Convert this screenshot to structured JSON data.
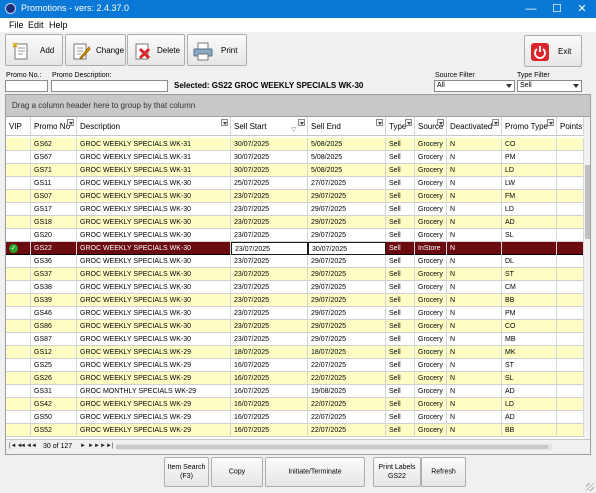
{
  "window": {
    "title": "Promotions - vers: 2.4.37.0",
    "minimize_glyph": "—",
    "maximize_glyph": "☐",
    "close_glyph": "✕"
  },
  "menu": [
    "File",
    "Edit",
    "Help"
  ],
  "toolbar": {
    "add_label": "Add",
    "change_label": "Change",
    "delete_label": "Delete",
    "print_label": "Print",
    "exit_label": "Exit"
  },
  "filters": {
    "promo_no_label": "Promo No.:",
    "promo_no_value": "",
    "promo_desc_label": "Promo Description:",
    "promo_desc_value": "",
    "selected_text": "Selected: GS22 GROC WEEKLY SPECIALS WK-30",
    "source_filter_label": "Source Filter",
    "source_filter_value": "All",
    "type_filter_label": "Type Filter",
    "type_filter_value": "Sell"
  },
  "grid": {
    "group_panel_text": "Drag a column header here to group by that column",
    "columns": [
      "VIP",
      "Promo No",
      "Description",
      "Sell Start",
      "Sell End",
      "Type",
      "Source",
      "Deactivated",
      "Promo Type",
      "Points Itm"
    ],
    "rows": [
      [
        "",
        "GS62",
        "GROC WEEKLY SPECIALS WK-31",
        "30/07/2025",
        "5/08/2025",
        "Sell",
        "Grocery",
        "N",
        "CO",
        ""
      ],
      [
        "",
        "GS67",
        "GROC WEEKLY SPECIALS WK-31",
        "30/07/2025",
        "5/08/2025",
        "Sell",
        "Grocery",
        "N",
        "PM",
        ""
      ],
      [
        "",
        "GS71",
        "GROC WEEKLY SPECIALS WK-31",
        "30/07/2025",
        "5/08/2025",
        "Sell",
        "Grocery",
        "N",
        "LD",
        ""
      ],
      [
        "",
        "GS11",
        "GROC WEEKLY SPECIALS WK-30",
        "25/07/2025",
        "27/07/2025",
        "Sell",
        "Grocery",
        "N",
        "LW",
        ""
      ],
      [
        "",
        "GS07",
        "GROC WEEKLY SPECIALS WK-30",
        "23/07/2025",
        "29/07/2025",
        "Sell",
        "Grocery",
        "N",
        "FM",
        ""
      ],
      [
        "",
        "GS17",
        "GROC WEEKLY SPECIALS WK-30",
        "23/07/2025",
        "29/07/2025",
        "Sell",
        "Grocery",
        "N",
        "LD",
        ""
      ],
      [
        "",
        "GS18",
        "GROC WEEKLY SPECIALS WK-30",
        "23/07/2025",
        "29/07/2025",
        "Sell",
        "Grocery",
        "N",
        "AD",
        ""
      ],
      [
        "",
        "GS20",
        "GROC WEEKLY SPECIALS WK-30",
        "23/07/2025",
        "29/07/2025",
        "Sell",
        "Grocery",
        "N",
        "SL",
        ""
      ],
      [
        "",
        "GS22",
        "GROC WEEKLY SPECIALS WK-30",
        "23/07/2025",
        "30/07/2025",
        "Sell",
        "InStore",
        "N",
        "",
        ""
      ],
      [
        "",
        "GS36",
        "GROC WEEKLY SPECIALS WK-30",
        "23/07/2025",
        "29/07/2025",
        "Sell",
        "Grocery",
        "N",
        "DL",
        ""
      ],
      [
        "",
        "GS37",
        "GROC WEEKLY SPECIALS WK-30",
        "23/07/2025",
        "29/07/2025",
        "Sell",
        "Grocery",
        "N",
        "ST",
        ""
      ],
      [
        "",
        "GS38",
        "GROC WEEKLY SPECIALS WK-30",
        "23/07/2025",
        "29/07/2025",
        "Sell",
        "Grocery",
        "N",
        "CM",
        ""
      ],
      [
        "",
        "GS39",
        "GROC WEEKLY SPECIALS WK-30",
        "23/07/2025",
        "29/07/2025",
        "Sell",
        "Grocery",
        "N",
        "BB",
        ""
      ],
      [
        "",
        "GS46",
        "GROC WEEKLY SPECIALS WK-30",
        "23/07/2025",
        "29/07/2025",
        "Sell",
        "Grocery",
        "N",
        "PM",
        ""
      ],
      [
        "",
        "GS86",
        "GROC WEEKLY SPECIALS WK-30",
        "23/07/2025",
        "29/07/2025",
        "Sell",
        "Grocery",
        "N",
        "CO",
        ""
      ],
      [
        "",
        "GS87",
        "GROC WEEKLY SPECIALS WK-30",
        "23/07/2025",
        "29/07/2025",
        "Sell",
        "Grocery",
        "N",
        "MB",
        ""
      ],
      [
        "",
        "GS12",
        "GROC WEEKLY SPECIALS WK-29",
        "18/07/2025",
        "18/07/2025",
        "Sell",
        "Grocery",
        "N",
        "MK",
        ""
      ],
      [
        "",
        "GS25",
        "GROC WEEKLY SPECIALS WK-29",
        "16/07/2025",
        "22/07/2025",
        "Sell",
        "Grocery",
        "N",
        "ST",
        ""
      ],
      [
        "",
        "GS26",
        "GROC WEEKLY SPECIALS WK-29",
        "16/07/2025",
        "22/07/2025",
        "Sell",
        "Grocery",
        "N",
        "SL",
        ""
      ],
      [
        "",
        "GS31",
        "GROC MONTHLY SPECIALS WK-29",
        "16/07/2025",
        "19/08/2025",
        "Sell",
        "Grocery",
        "N",
        "AD",
        ""
      ],
      [
        "",
        "GS42",
        "GROC WEEKLY SPECIALS WK-29",
        "16/07/2025",
        "22/07/2025",
        "Sell",
        "Grocery",
        "N",
        "LD",
        ""
      ],
      [
        "",
        "GS50",
        "GROC WEEKLY SPECIALS WK-29",
        "16/07/2025",
        "22/07/2025",
        "Sell",
        "Grocery",
        "N",
        "AD",
        ""
      ],
      [
        "",
        "GS52",
        "GROC WEEKLY SPECIALS WK-29",
        "16/07/2025",
        "22/07/2025",
        "Sell",
        "Grocery",
        "N",
        "BB",
        ""
      ]
    ],
    "selected_row": 8,
    "record_counter": "30 of 127",
    "nav_first": "|◄◄",
    "nav_prev_page": "◄◄",
    "nav_prev": "◄",
    "nav_next": "►",
    "nav_next_page": "►►",
    "nav_last": "►►|"
  },
  "bottom": {
    "item_search": "Item Search\n(F3)",
    "copy": "Copy",
    "initiate": "Initiate/Terminate",
    "print_labels": "Print Labels\nGS22",
    "refresh": "Refresh"
  },
  "colors": {
    "titlebar": "#0a78d7",
    "row_alt": "#ffffc5",
    "row_selected": "#6b0a0f",
    "exit_icon": "#d9262c",
    "delete_icon": "#d9262c",
    "vip_check": "#28a428"
  }
}
